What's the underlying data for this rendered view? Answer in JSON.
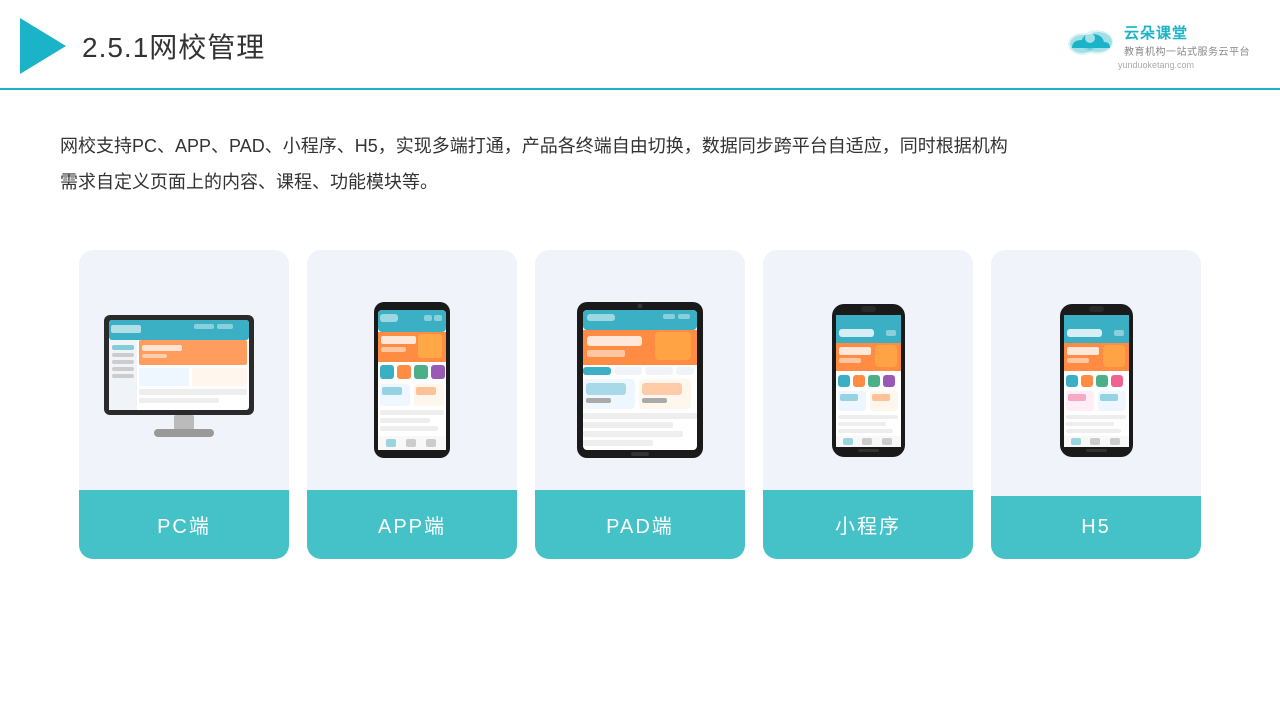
{
  "header": {
    "title_prefix": "2.5.1",
    "title_main": "网校管理",
    "brand_name": "云朵课堂",
    "brand_url": "yunduoketang.com",
    "brand_tagline": "教育机构一站\n式服务云平台"
  },
  "description": {
    "text1": "网校支持PC、APP、PAD、小程序、H5，实现多端打通，产品各终端自由切换，数据同步跨平台自适应，同时根据机构",
    "text2": "需求自定义页面上的内容、课程、功能模块等。"
  },
  "cards": [
    {
      "id": "pc",
      "label": "PC端"
    },
    {
      "id": "app",
      "label": "APP端"
    },
    {
      "id": "pad",
      "label": "PAD端"
    },
    {
      "id": "miniapp",
      "label": "小程序"
    },
    {
      "id": "h5",
      "label": "H5"
    }
  ],
  "colors": {
    "accent": "#1ab3c8",
    "card_bg": "#eef2f8",
    "card_label_bg": "#45c1c8",
    "card_label_text": "#ffffff"
  }
}
